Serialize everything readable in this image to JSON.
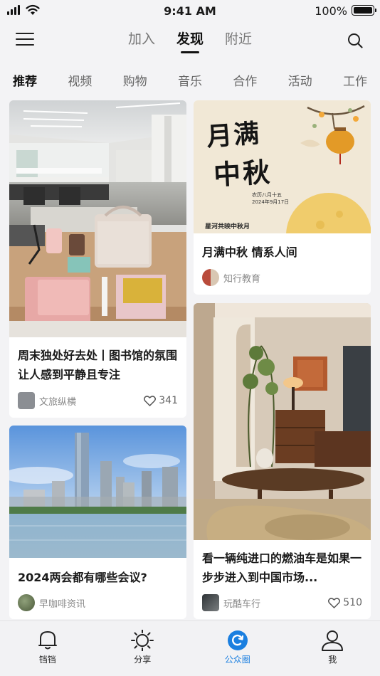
{
  "status_bar": {
    "time": "9:41 AM",
    "battery": "100%"
  },
  "header": {
    "tabs": [
      {
        "label": "加入",
        "active": false
      },
      {
        "label": "发现",
        "active": true
      },
      {
        "label": "附近",
        "active": false
      }
    ]
  },
  "categories": [
    {
      "label": "推荐",
      "active": true
    },
    {
      "label": "视频",
      "active": false
    },
    {
      "label": "购物",
      "active": false
    },
    {
      "label": "音乐",
      "active": false
    },
    {
      "label": "合作",
      "active": false
    },
    {
      "label": "活动",
      "active": false
    },
    {
      "label": "工作",
      "active": false
    }
  ],
  "feed": [
    {
      "title": "周末独处好去处丨图书馆的氛围让人感到平静且专注",
      "source": "文旅纵横",
      "likes": "341"
    },
    {
      "title": "月满中秋 情系人间",
      "source": "知行教育",
      "likes": "",
      "image_text": {
        "headline_1": "月满",
        "headline_2": "中秋",
        "date_1": "农历八月十五",
        "date_2": "2024年9月17日",
        "tagline": "星河共映中秋月"
      }
    },
    {
      "title": "2024两会都有哪些会议?",
      "source": "早咖啡资讯",
      "likes": ""
    },
    {
      "title": "看一辆纯进口的燃油车是如果一步步进入到中国市场...",
      "source": "玩酷车行",
      "likes": "510"
    }
  ],
  "bottom_nav": [
    {
      "label": "铛铛",
      "icon": "bell-icon",
      "active": false
    },
    {
      "label": "分享",
      "icon": "sun-icon",
      "active": false
    },
    {
      "label": "公众圈",
      "icon": "circle-refresh-icon",
      "active": true
    },
    {
      "label": "我",
      "icon": "person-icon",
      "active": false
    }
  ],
  "colors": {
    "accent": "#1a7fe0",
    "background": "#f3f3f5",
    "card": "#ffffff"
  }
}
